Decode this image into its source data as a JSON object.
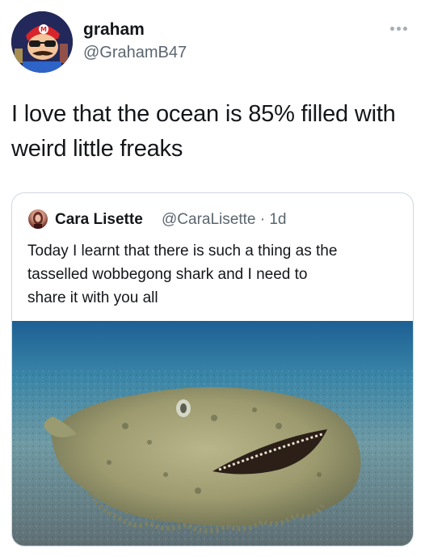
{
  "author": {
    "name": "graham",
    "handle": "@GrahamB47",
    "avatar_icon": "mario-avatar-icon"
  },
  "tweet": {
    "text_line1": "I love that the ocean is 85% filled with",
    "text_line2": "weird little freaks"
  },
  "more_icon": "ellipsis-icon",
  "quoted": {
    "name": "Cara Lisette",
    "handle_time": "@CaraLisette · 1d",
    "text_line1": "Today I learnt that there is such a thing as the",
    "text_line2": "tasselled wobbegong shark and I need to",
    "text_line3": "share it with you all",
    "media_icon": "wobbegong-shark-photo"
  },
  "colors": {
    "text": "#14171a",
    "secondary": "#5b6670",
    "border": "#cfd9de"
  }
}
